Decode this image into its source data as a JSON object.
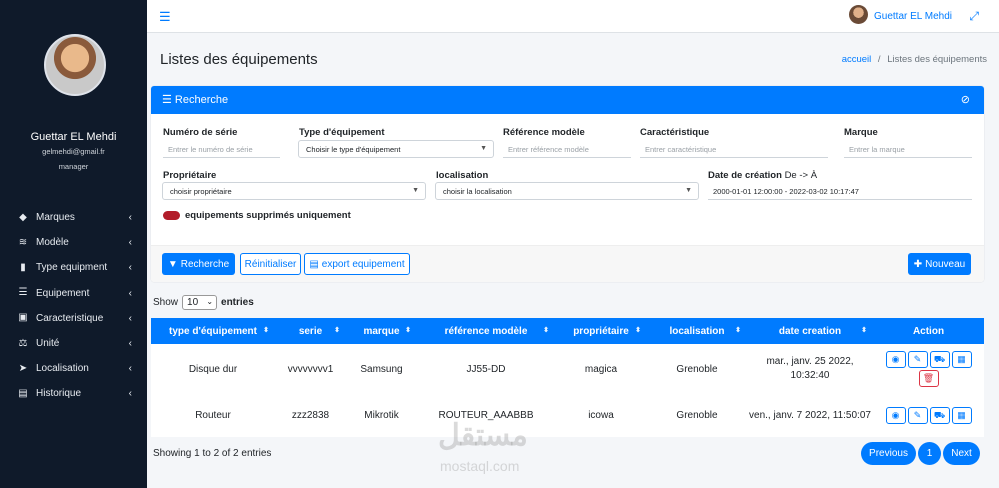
{
  "sidebar": {
    "user_name": "Guettar EL Mehdi",
    "email": "gelmehdi@gmail.fr",
    "role": "manager",
    "items": [
      {
        "label": "Marques",
        "icon": "tags-icon"
      },
      {
        "label": "Modèle",
        "icon": "layers-icon"
      },
      {
        "label": "Type equipment",
        "icon": "battery-icon"
      },
      {
        "label": "Equipement",
        "icon": "list-icon"
      },
      {
        "label": "Caracteristique",
        "icon": "id-card-icon"
      },
      {
        "label": "Unité",
        "icon": "scale-icon"
      },
      {
        "label": "Localisation",
        "icon": "location-arrow-icon"
      },
      {
        "label": "Historique",
        "icon": "book-icon"
      }
    ]
  },
  "topbar": {
    "user_name": "Guettar EL Mehdi"
  },
  "page": {
    "title": "Listes des équipements"
  },
  "breadcrumb": {
    "home": "accueil",
    "separator": "/",
    "current": "Listes des équipements"
  },
  "search_card": {
    "title": "Recherche",
    "fields": {
      "serial": {
        "label": "Numéro de série",
        "placeholder": "Entrer le numéro de série"
      },
      "type": {
        "label": "Type d'équipement",
        "value": "Choisir le type d'équipement"
      },
      "model_ref": {
        "label": "Référence modèle",
        "placeholder": "Entrer référence modèle"
      },
      "characteristic": {
        "label": "Caractéristique",
        "placeholder": "Entrer caractéristique"
      },
      "brand": {
        "label": "Marque",
        "placeholder": "Entrer la marque"
      },
      "owner": {
        "label": "Propriétaire",
        "value": "choisir propriétaire"
      },
      "location": {
        "label": "localisation",
        "value": "choisir la localisation"
      },
      "date": {
        "label": "Date de création",
        "label_suffix": "De -> À",
        "value": "2000-01-01 12:00:00 - 2022-03-02 10:17:47"
      }
    },
    "deleted_toggle_label": "equipements supprimés uniquement",
    "buttons": {
      "search": "Recherche",
      "reset": "Réinitialiser",
      "export": "export equipement",
      "new": "Nouveau"
    }
  },
  "table_controls": {
    "show": "Show",
    "page_size": "10",
    "entries": "entries"
  },
  "table": {
    "columns": [
      "type d'équipement",
      "serie",
      "marque",
      "référence modèle",
      "propriétaire",
      "localisation",
      "date creation",
      "Action"
    ],
    "rows": [
      {
        "type": "Disque dur",
        "serie": "vvvvvvvv1",
        "marque": "Samsung",
        "ref": "JJ55-DD",
        "owner": "magica",
        "location": "Grenoble",
        "date_line1": "mar., janv. 25 2022,",
        "date_line2": "10:32:40"
      },
      {
        "type": "Routeur",
        "serie": "zzz2838",
        "marque": "Mikrotik",
        "ref": "ROUTEUR_AAABBB",
        "owner": "icowa",
        "location": "Grenoble",
        "date_line1": "ven., janv. 7 2022, 11:50:07",
        "date_line2": ""
      }
    ]
  },
  "footer": {
    "info": "Showing 1 to 2 of 2 entries",
    "previous": "Previous",
    "page": "1",
    "next": "Next"
  },
  "watermark": {
    "arabic": "مستقل",
    "latin": "mostaql.com"
  },
  "colors": {
    "primary": "#007bff",
    "sidebar": "#0f1a2a",
    "danger": "#dc3545"
  }
}
